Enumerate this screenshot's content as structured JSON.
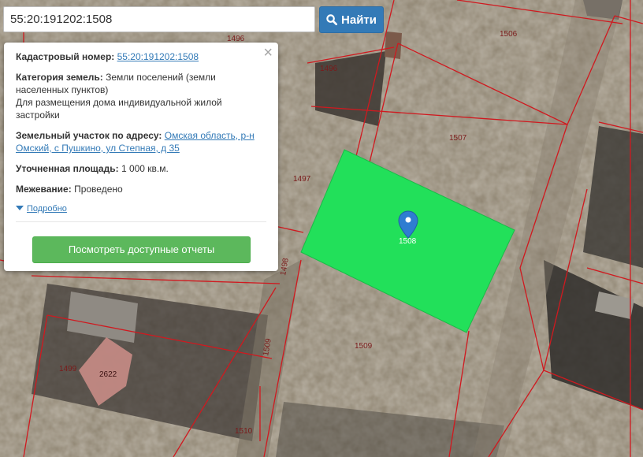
{
  "search": {
    "value": "55:20:191202:1508"
  },
  "find_button": {
    "label": "Найти",
    "icon": "search-icon"
  },
  "popup": {
    "cadastral_label": "Кадастровый номер:",
    "cadastral_value": "55:20:191202:1508",
    "category_label": "Категория земель:",
    "category_value_1": "Земли поселений (земли",
    "category_value_2": "населенных пунктов)",
    "usage_1": "Для размещения дома индивидуальной жилой",
    "usage_2": "застройки",
    "address_label": "Земельный участок по адресу:",
    "address_value_1": "Омская область, р-н",
    "address_value_2": "Омский, с Пушкино, ул Степная, д 35",
    "area_label": "Уточненная площадь:",
    "area_value": "1 000 кв.м.",
    "survey_label": "Межевание:",
    "survey_value": "Проведено",
    "more_link": "Подробно",
    "reports_button": "Посмотреть доступные отчеты",
    "close_symbol": "×"
  },
  "map": {
    "highlight_color": "#22e05a",
    "boundary_color": "#d0191f",
    "marker_color": "#2f7dd1",
    "plot_labels": [
      "1496",
      "1496",
      "1506",
      "1507",
      "1497",
      "1508",
      "1498",
      "1509",
      "1509",
      "1499",
      "2622",
      "1510"
    ]
  }
}
